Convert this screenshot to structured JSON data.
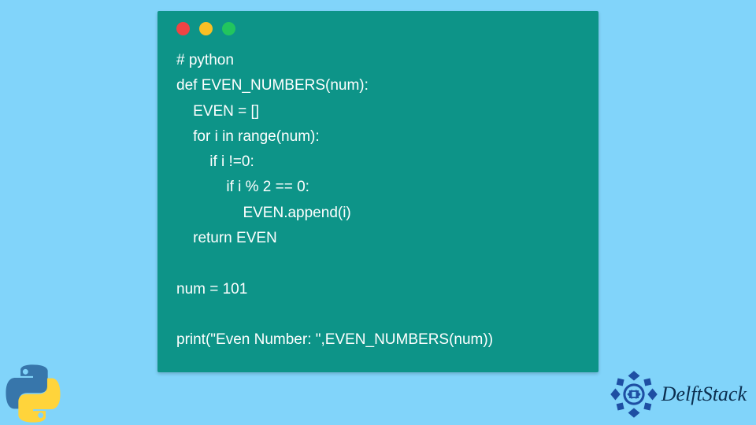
{
  "window": {
    "dots": [
      "red",
      "yellow",
      "green"
    ]
  },
  "code": {
    "lines": [
      "# python",
      "def EVEN_NUMBERS(num):",
      "    EVEN = []",
      "    for i in range(num):",
      "        if i !=0:",
      "            if i % 2 == 0:",
      "                EVEN.append(i)",
      "    return EVEN",
      "",
      "num = 101",
      "",
      "print(\"Even Number: \",EVEN_NUMBERS(num))"
    ]
  },
  "branding": {
    "name": "DelftStack"
  },
  "icons": {
    "python": "python-logo",
    "delftstack": "delftstack-logo"
  }
}
